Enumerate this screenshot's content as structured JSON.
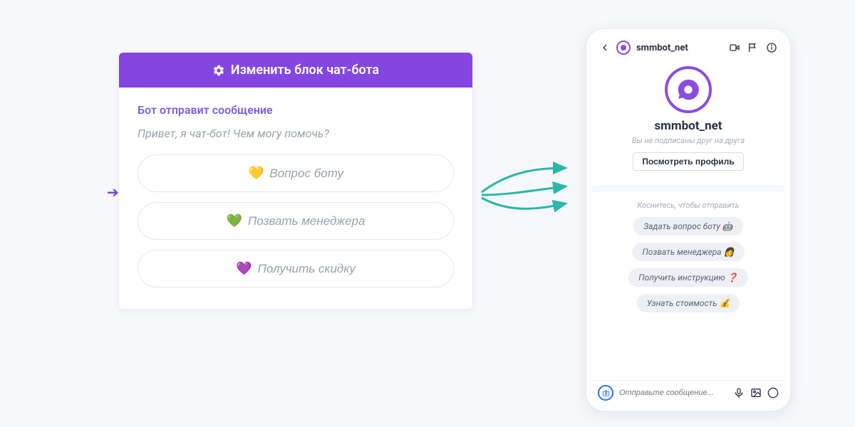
{
  "editor": {
    "header_label": "Изменить блок чат-бота",
    "section_label": "Бот отправит сообщение",
    "message_text": "Привет, я чат-бот! Чем могу помочь?",
    "options": [
      {
        "icon": "💛",
        "label": "Вопрос боту"
      },
      {
        "icon": "💚",
        "label": "Позвать менеджера"
      },
      {
        "icon": "💜",
        "label": "Получить скидку"
      }
    ]
  },
  "phone": {
    "top_title": "smmbot_net",
    "profile_name": "smmbot_net",
    "profile_subtitle": "Вы не подписаны друг на друга",
    "view_profile_label": "Посмотреть профиль",
    "reply_hint": "Коснитесь, чтобы отправить",
    "chips": [
      "Задать вопрос боту 🤖",
      "Позвать менеджера 👩",
      "Получить инструкцию ❓",
      "Узнать стоимость 💰"
    ],
    "composer_placeholder": "Отправьте сообщение..."
  },
  "colors": {
    "accent": "#8445e1",
    "teal_arrow": "#2ab7a9"
  }
}
